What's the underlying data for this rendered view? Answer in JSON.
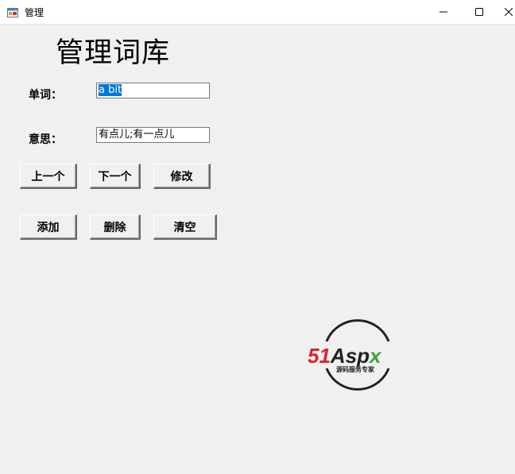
{
  "window": {
    "title": "管理"
  },
  "heading": "管理词库",
  "form": {
    "word_label": "单词：",
    "word_value": "a bit",
    "meaning_label": "意思：",
    "meaning_value": "有点儿;有一点儿"
  },
  "buttons": {
    "prev": "上一个",
    "next": "下一个",
    "edit": "修改",
    "add": "添加",
    "delete": "删除",
    "clear": "清空"
  },
  "logo": {
    "brand_red": "51",
    "brand_dark": "Asp",
    "brand_green": "x",
    "tagline": "源码服务专家",
    "colors": {
      "red": "#d9232d",
      "dark": "#222222",
      "green": "#3aa53a"
    }
  },
  "icons": {
    "app": "app-window-icon",
    "minimize": "minimize-icon",
    "maximize": "maximize-icon",
    "close": "close-icon"
  }
}
